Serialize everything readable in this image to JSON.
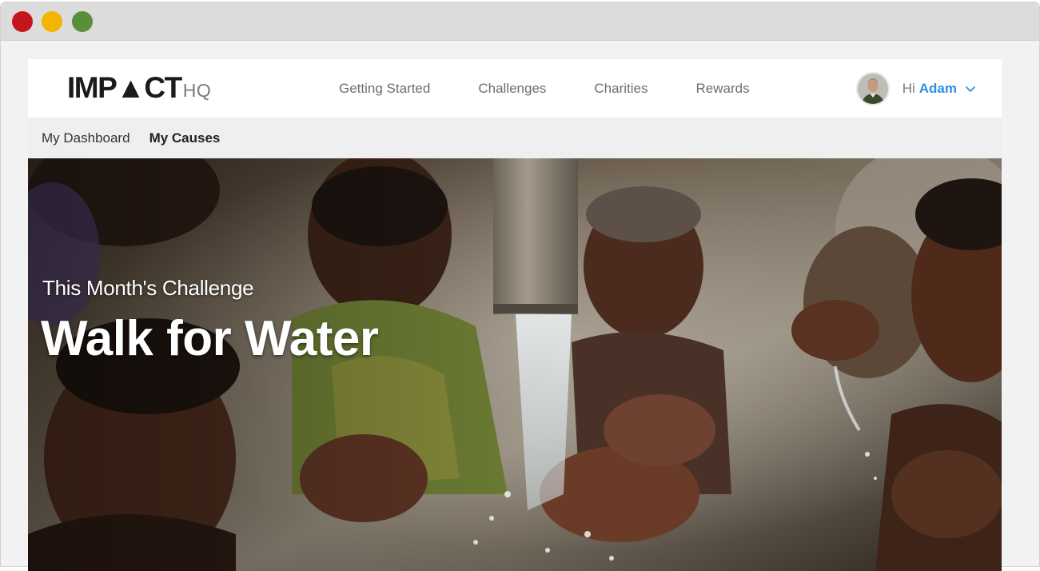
{
  "window": {
    "controls": [
      "close",
      "minimize",
      "maximize"
    ],
    "colors": {
      "close": "#c4161c",
      "minimize": "#f4b400",
      "maximize": "#5a8f3a"
    }
  },
  "header": {
    "logo_main": "IMP▲CT",
    "logo_sub": "HQ",
    "nav": [
      "Getting Started",
      "Challenges",
      "Charities",
      "Rewards"
    ],
    "greeting": "Hi",
    "user_name": "Adam",
    "user_name_color": "#2f8fde"
  },
  "subnav": {
    "items": [
      {
        "label": "My Dashboard",
        "active": false
      },
      {
        "label": "My Causes",
        "active": true
      }
    ]
  },
  "hero": {
    "kicker": "This Month's Challenge",
    "title": "Walk for Water"
  }
}
